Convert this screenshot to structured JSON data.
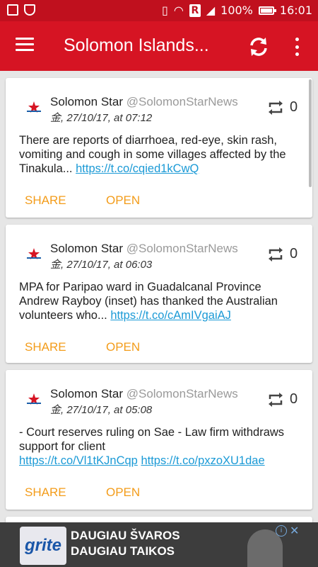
{
  "status_bar": {
    "battery": "100%",
    "time": "16:01",
    "r_badge": "R",
    "battery_level": 1.0
  },
  "appbar": {
    "title": "Solomon Islands..."
  },
  "tweets": [
    {
      "name": "Solomon Star",
      "handle": "@SolomonStarNews",
      "date": "金, 27/10/17, at 07:12",
      "retweets": "0",
      "text": "There are reports of diarrhoea, red-eye, skin rash, vomiting and cough in some villages affected by the Tinakula... ",
      "link": "https://t.co/cqied1kCwQ",
      "share": "SHARE",
      "open": "OPEN"
    },
    {
      "name": "Solomon Star",
      "handle": "@SolomonStarNews",
      "date": "金, 27/10/17, at 06:03",
      "retweets": "0",
      "text": "MPA for Paripao ward in Guadalcanal Province Andrew Rayboy (inset) has thanked the Australian volunteers who... ",
      "link": "https://t.co/cAmIVgaiAJ",
      "share": "SHARE",
      "open": "OPEN"
    },
    {
      "name": "Solomon Star",
      "handle": "@SolomonStarNews",
      "date": "金, 27/10/17, at 05:08",
      "retweets": "0",
      "text": "- Court reserves ruling on Sae - Law firm withdraws support for client ",
      "link": "https://t.co/Vl1tKJnCqp",
      "link2": "https://t.co/pxzoXU1dae",
      "share": "SHARE",
      "open": "OPEN"
    }
  ],
  "ad": {
    "brand": "grite",
    "line1": "DAUGIAU ŠVAROS",
    "line2": "DAUGIAU TAIKOS"
  }
}
